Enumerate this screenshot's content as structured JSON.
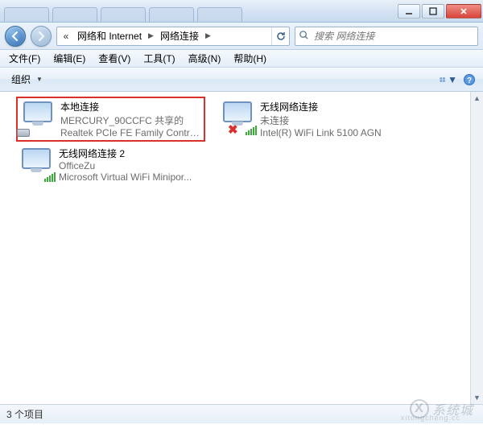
{
  "breadcrumb": {
    "back_chev": "«",
    "seg1": "网络和 Internet",
    "seg2": "网络连接"
  },
  "search": {
    "placeholder": "搜索 网络连接"
  },
  "menu": {
    "file": "文件(F)",
    "edit": "编辑(E)",
    "view": "查看(V)",
    "tools": "工具(T)",
    "advanced": "高级(N)",
    "help": "帮助(H)"
  },
  "toolbar": {
    "organize": "组织"
  },
  "items": [
    {
      "name": "本地连接",
      "sub1": "MERCURY_90CCFC 共享的",
      "sub2": "Realtek PCIe FE Family Control...",
      "selected": true,
      "wireless": false,
      "disconnected": false
    },
    {
      "name": "无线网络连接",
      "sub1": "未连接",
      "sub2": "Intel(R) WiFi Link 5100 AGN",
      "selected": false,
      "wireless": true,
      "disconnected": true
    },
    {
      "name": "无线网络连接 2",
      "sub1": "OfficeZu",
      "sub2": "Microsoft Virtual WiFi Minipor...",
      "selected": false,
      "wireless": true,
      "disconnected": false
    }
  ],
  "status": {
    "count": "3 个项目"
  },
  "watermark": {
    "logo": "X",
    "text": "系统城",
    "url": "xitongcheng.cc"
  }
}
